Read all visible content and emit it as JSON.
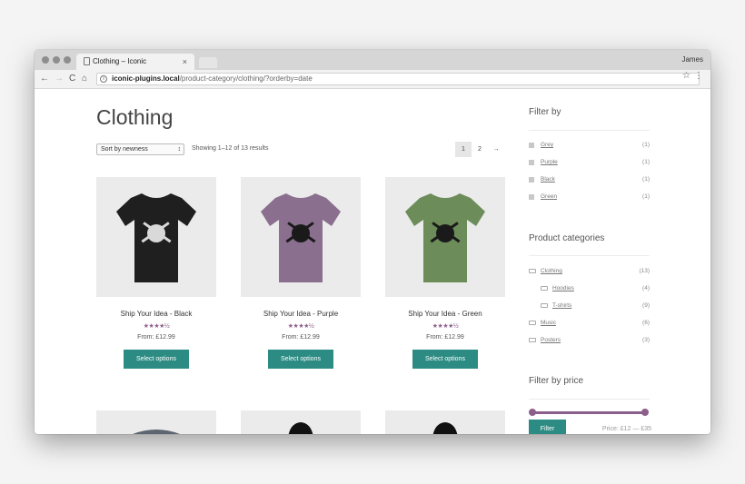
{
  "browser": {
    "tab_title": "Clothing – Iconic",
    "tab_close": "×",
    "user": "James",
    "url_host": "iconic-plugins.local",
    "url_path": "/product-category/clothing/?orderby=date",
    "nav": {
      "back": "←",
      "forward": "→",
      "reload": "C",
      "home": "⌂"
    },
    "star": "☆",
    "menu": "⋮",
    "info": "i"
  },
  "page": {
    "title": "Clothing",
    "sort_value": "Sort by newness",
    "sort_arrows": "↕",
    "result_count": "Showing 1–12 of 13 results",
    "pagination": [
      "1",
      "2",
      "→"
    ]
  },
  "products": [
    {
      "name": "Ship Your Idea - Black",
      "stars": "★★★★½",
      "rating": 4.5,
      "price": "From: £12.99",
      "button": "Select options",
      "shirt_color": "#1f1f1f",
      "print_color": "#d9d9d9"
    },
    {
      "name": "Ship Your Idea - Purple",
      "stars": "★★★★½",
      "rating": 4.5,
      "price": "From: £12.99",
      "button": "Select options",
      "shirt_color": "#8a6f8e",
      "print_color": "#1a1a1a"
    },
    {
      "name": "Ship Your Idea - Green",
      "stars": "★★★★½",
      "rating": 4.5,
      "price": "From: £12.99",
      "button": "Select options",
      "shirt_color": "#6c8d5a",
      "print_color": "#1a1a1a"
    }
  ],
  "sidebar": {
    "filter_by_title": "Filter by",
    "colors": [
      {
        "label": "Grey",
        "count": "(1)"
      },
      {
        "label": "Purple",
        "count": "(1)"
      },
      {
        "label": "Black",
        "count": "(1)"
      },
      {
        "label": "Green",
        "count": "(1)"
      }
    ],
    "categories_title": "Product categories",
    "categories": [
      {
        "label": "Clothing",
        "count": "(13)",
        "indent": false
      },
      {
        "label": "Hoodies",
        "count": "(4)",
        "indent": true
      },
      {
        "label": "T-shirts",
        "count": "(9)",
        "indent": true
      },
      {
        "label": "Music",
        "count": "(6)",
        "indent": false
      },
      {
        "label": "Posters",
        "count": "(3)",
        "indent": false
      }
    ],
    "price_title": "Filter by price",
    "filter_button": "Filter",
    "price_range": "Price: £12 — £35"
  },
  "colors": {
    "accent_teal": "#2c8c83",
    "accent_purple": "#8c5e8a"
  }
}
